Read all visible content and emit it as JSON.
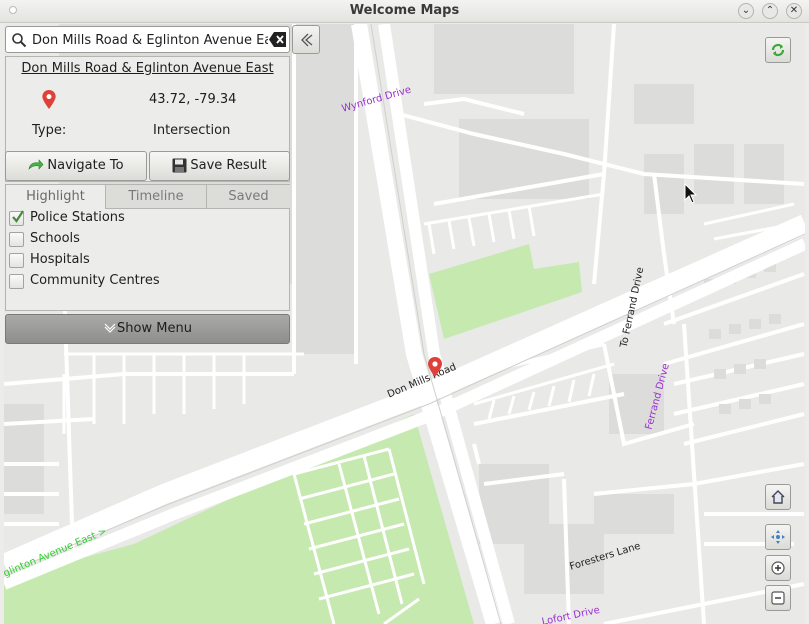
{
  "window": {
    "title": "Welcome Maps"
  },
  "search": {
    "value": "Don Mills Road & Eglinton Avenue Ea"
  },
  "result": {
    "title": "Don Mills Road & Eglinton Avenue East",
    "coords": "43.72, -79.34",
    "type_label": "Type:",
    "type_value": "Intersection"
  },
  "actions": {
    "navigate_label": "Navigate To",
    "save_label": "Save Result"
  },
  "tabs": [
    {
      "label": "Highlight"
    },
    {
      "label": "Timeline"
    },
    {
      "label": "Saved"
    }
  ],
  "highlight_items": [
    {
      "label": "Police Stations",
      "checked": true
    },
    {
      "label": "Schools",
      "checked": false
    },
    {
      "label": "Hospitals",
      "checked": false
    },
    {
      "label": "Community Centres",
      "checked": false
    }
  ],
  "show_menu_label": "Show Menu",
  "map_labels": {
    "wynford": "Wynford Drive",
    "don_mills": "Don Mills Road",
    "to_ferrand": "To Ferrand Drive",
    "ferrand": "Ferrand Drive",
    "eglinton": "glinton Avenue East  >",
    "foresters": "Foresters Lane",
    "bottom": "Lofort Drive"
  },
  "colors": {
    "road_label_purple": "#9b30d0",
    "road_label_green": "#33cc33",
    "park": "#c6e9b0",
    "pin": "#e0403a"
  },
  "icons": {
    "search": "search-icon",
    "clear": "clear-icon",
    "back": "back-arrow-icon",
    "pin": "location-pin-icon",
    "navigate": "navigate-arrow-icon",
    "save": "floppy-disk-icon",
    "menu": "chevron-down-icon",
    "refresh": "refresh-icon",
    "home": "home-icon",
    "pan": "pan-icon",
    "zoom_in": "zoom-in-icon",
    "zoom_out": "zoom-out-icon"
  }
}
